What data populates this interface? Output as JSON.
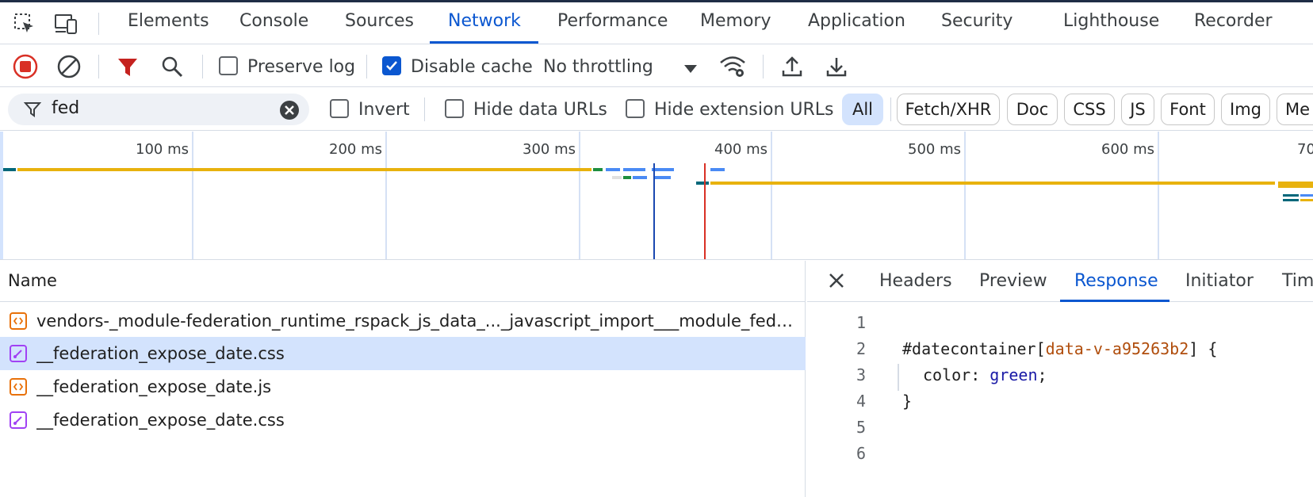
{
  "main_tabs": {
    "items": [
      {
        "label": "Elements"
      },
      {
        "label": "Console"
      },
      {
        "label": "Sources"
      },
      {
        "label": "Network"
      },
      {
        "label": "Performance"
      },
      {
        "label": "Memory"
      },
      {
        "label": "Application"
      },
      {
        "label": "Security"
      },
      {
        "label": "Lighthouse"
      },
      {
        "label": "Recorder"
      }
    ],
    "active": "Network",
    "icons": [
      "inspect-element-icon",
      "device-toolbar-icon"
    ]
  },
  "toolbar": {
    "preserve_log": {
      "label": "Preserve log",
      "checked": false
    },
    "disable_cache": {
      "label": "Disable cache",
      "checked": true
    },
    "throttling": "No throttling",
    "icons": [
      "stop-recording-icon",
      "clear-icon",
      "filter-icon",
      "search-icon",
      "network-conditions-icon",
      "import-har-icon",
      "export-har-icon"
    ]
  },
  "filter": {
    "value": "fed",
    "invert": {
      "label": "Invert",
      "checked": false
    },
    "hide_data_urls": {
      "label": "Hide data URLs",
      "checked": false
    },
    "hide_extension_urls": {
      "label": "Hide extension URLs",
      "checked": false
    },
    "types": [
      "All",
      "Fetch/XHR",
      "Doc",
      "CSS",
      "JS",
      "Font",
      "Img",
      "Me"
    ],
    "active_type": "All"
  },
  "overview": {
    "ticks": [
      "100 ms",
      "200 ms",
      "300 ms",
      "400 ms",
      "500 ms",
      "600 ms",
      "70"
    ],
    "dom_content_loaded_ms": 338,
    "load_ms": 365
  },
  "request_list": {
    "header": "Name",
    "rows": [
      {
        "name": "vendors-_module-federation_runtime_rspack_js_data_..._javascript_import___module_fede...",
        "type": "js",
        "selected": false
      },
      {
        "name": "__federation_expose_date.css",
        "type": "css",
        "selected": true
      },
      {
        "name": "__federation_expose_date.js",
        "type": "js",
        "selected": false
      },
      {
        "name": "__federation_expose_date.css",
        "type": "css",
        "selected": false
      }
    ]
  },
  "details": {
    "tabs": [
      "Headers",
      "Preview",
      "Response",
      "Initiator",
      "Tim"
    ],
    "active_tab": "Response",
    "code": {
      "line_numbers": [
        "1",
        "2",
        "3",
        "4",
        "5",
        "6"
      ],
      "line2": {
        "hash_sel": "#datecontainer",
        "bracket_open": "[",
        "attr": "data-v-a95263b2",
        "bracket_close": "] {"
      },
      "line3": {
        "prop": "color: ",
        "val": "green",
        "semi": ";"
      },
      "line4": "}"
    }
  },
  "colors": {
    "accent": "#0b57d0",
    "record_red": "#d93025",
    "filter_red": "#c5221f",
    "waterfall_yellow": "#e8b20e",
    "waterfall_blue": "#4a8af4",
    "waterfall_green": "#1e8e3e",
    "waterfall_teal": "#00677a",
    "dcl_blue": "#1a48b0",
    "load_red": "#d93025",
    "css_purple": "#a142f4",
    "js_orange": "#e8710a"
  }
}
